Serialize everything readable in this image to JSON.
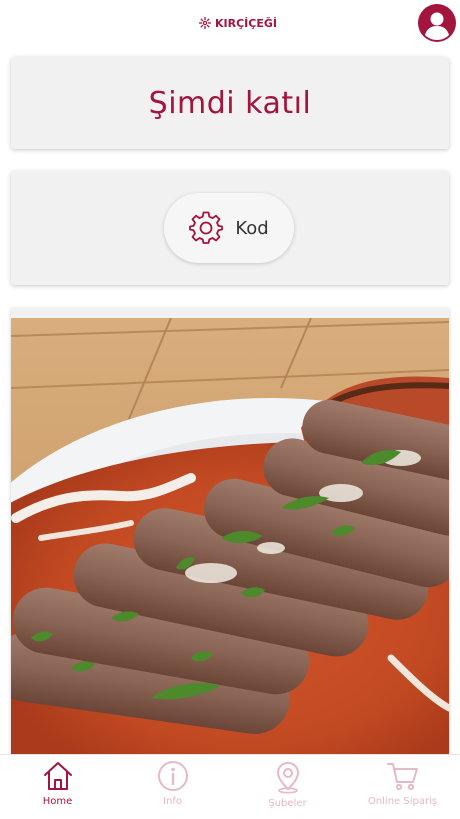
{
  "header": {
    "brand": "KIRÇİÇEĞİ",
    "logo_icon": "flower-logo-icon",
    "profile_icon": "user-profile-icon"
  },
  "join_card": {
    "label": "Şimdi katıl"
  },
  "code_card": {
    "icon": "gear-icon",
    "label": "Kod"
  },
  "promo": {
    "image": "grilled-kofte-plate"
  },
  "tabbar": {
    "items": [
      {
        "label": "Home",
        "icon": "home-icon",
        "active": true
      },
      {
        "label": "Info",
        "icon": "info-icon",
        "active": false
      },
      {
        "label": "Şubeler",
        "icon": "location-pin-icon",
        "active": false
      },
      {
        "label": "Online Sipariş",
        "icon": "cart-icon",
        "active": false
      }
    ]
  },
  "colors": {
    "brand": "#a3153c",
    "brand_light": "#e7b8c6",
    "card_bg": "#f1f1f1"
  }
}
